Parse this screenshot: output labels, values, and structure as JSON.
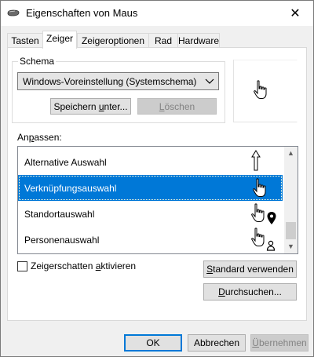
{
  "window": {
    "title": "Eigenschaften von Maus",
    "close_glyph": "✕"
  },
  "tabs": [
    {
      "label": "Tasten",
      "active": false
    },
    {
      "label": "Zeiger",
      "active": true
    },
    {
      "label": "Zeigeroptionen",
      "active": false
    },
    {
      "label": "Rad",
      "active": false
    },
    {
      "label": "Hardware",
      "active": false
    }
  ],
  "schema": {
    "group_label": "Schema",
    "selected": "Windows-Voreinstellung (Systemschema)",
    "save_button": {
      "pre": "Speichern ",
      "accel": "u",
      "post": "nter..."
    },
    "delete_button": {
      "accel": "L",
      "post": "öschen",
      "disabled": true
    }
  },
  "customize": {
    "label": {
      "pre": "An",
      "accel": "p",
      "post": "assen:"
    },
    "items": [
      {
        "label": "Alternative Auswahl",
        "icon": "up-arrow-cursor-icon",
        "selected": false
      },
      {
        "label": "Verknüpfungsauswahl",
        "icon": "hand-link-cursor-icon",
        "selected": true
      },
      {
        "label": "Standortauswahl",
        "icon": "hand-location-cursor-icon",
        "selected": false
      },
      {
        "label": "Personenauswahl",
        "icon": "hand-person-cursor-icon",
        "selected": false
      }
    ]
  },
  "shadow_checkbox": {
    "pre": "Zeigerschatten ",
    "accel": "a",
    "post": "ktivieren",
    "checked": false
  },
  "buttons": {
    "default": {
      "accel": "S",
      "post": "tandard verwenden"
    },
    "browse": {
      "accel": "D",
      "post": "urchsuchen..."
    },
    "ok": "OK",
    "cancel": "Abbrechen",
    "apply": {
      "accel": "Ü",
      "post": "bernehmen",
      "disabled": true
    }
  },
  "colors": {
    "selection": "#0078d7",
    "window_bg": "#f0f0f0",
    "panel_bg": "#ffffff"
  }
}
